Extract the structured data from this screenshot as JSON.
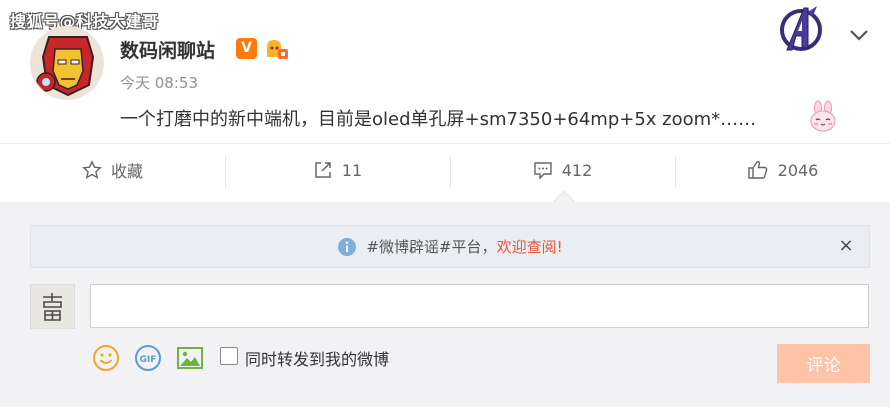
{
  "watermark": "搜狐号@科技大建哥",
  "post": {
    "author": "数码闲聊站",
    "vip_badge": "V",
    "time": "今天 08:53",
    "text": "一个打磨中的新中端机，目前是oled单孔屏+sm7350+64mp+5x zoom*……"
  },
  "actions": {
    "favorite_label": "收藏",
    "repost_count": "11",
    "comment_count": "412",
    "like_count": "2046"
  },
  "notice": {
    "prefix": "#微博辟谣#平台，",
    "link": "欢迎查阅!",
    "close": "×"
  },
  "composer": {
    "placeholder": "",
    "repost_label": "同时转发到我的微博",
    "submit_label": "评论",
    "gif_label": "GIF"
  },
  "colors": {
    "accent_orange": "#ff7a0d",
    "notice_link": "#e8553b",
    "submit_disabled": "#ffc3a8"
  }
}
